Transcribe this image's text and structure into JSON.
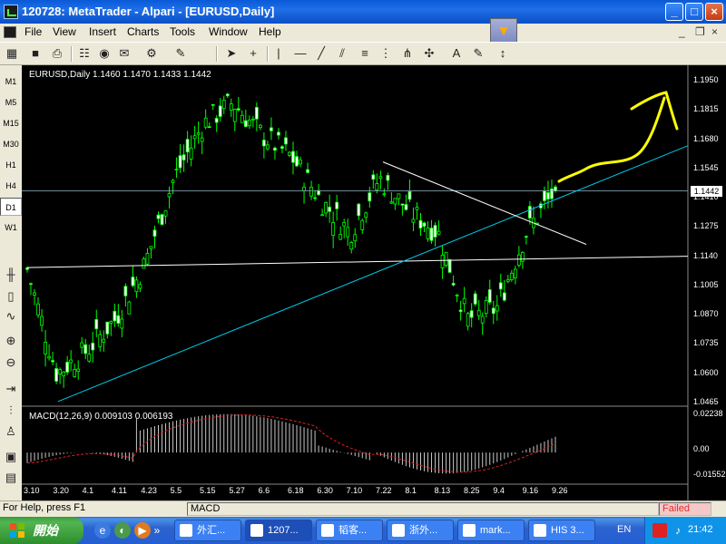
{
  "window": {
    "title": "120728: MetaTrader - Alpari - [EURUSD,Daily]"
  },
  "menu": [
    "File",
    "View",
    "Insert",
    "Charts",
    "Tools",
    "Window",
    "Help"
  ],
  "toolbar": {
    "icons": [
      "new-chart-icon",
      "save-icon",
      "print-icon",
      "market-watch-icon",
      "data-window-icon",
      "navigator-icon",
      "terminal-icon",
      "options-icon",
      "edit-icon",
      "cursor-icon",
      "crosshair-icon",
      "vertical-line-icon",
      "horizontal-line-icon",
      "trendline-icon",
      "channel-icon",
      "fibonacci-icon",
      "gann-icon",
      "pitchfork-icon",
      "text-icon",
      "label-icon",
      "arrows-icon",
      "period-icon"
    ]
  },
  "timeframes": [
    "M1",
    "M5",
    "M15",
    "M30",
    "H1",
    "H4",
    "D1",
    "W1"
  ],
  "active_timeframe": "D1",
  "chart": {
    "info_label": "EURUSD,Daily  1.1460 1.1470 1.1433 1.1442",
    "current_price": "1.1442",
    "price_ticks": [
      "1.1950",
      "1.1815",
      "1.1680",
      "1.1545",
      "1.1410",
      "1.1275",
      "1.1140",
      "1.1005",
      "1.0870",
      "1.0735",
      "1.0600",
      "1.0465"
    ],
    "date_ticks": [
      "3.10",
      "3.20",
      "4.1",
      "4.11",
      "4.23",
      "5.5",
      "5.15",
      "5.27",
      "6.6",
      "6.18",
      "6.30",
      "7.10",
      "7.22",
      "8.1",
      "8.13",
      "8.25",
      "9.4",
      "9.16",
      "9.26"
    ],
    "macd_label": "MACD(12,26,9)  0.009103  0.006193",
    "macd_ticks": [
      "0.02238",
      "0.00",
      "-0.01552"
    ],
    "colors": {
      "bull": "#00ff00",
      "bear": "#00ff00",
      "trendline": "#00c8e6",
      "hline": "#ffffff",
      "annotation": "#ffff00"
    }
  },
  "chart_data": {
    "type": "candlestick",
    "title": "",
    "symbol": "EURUSD",
    "timeframe": "Daily",
    "ylim": [
      1.0465,
      1.195
    ],
    "close_path": [
      [
        "3.10",
        1.108
      ],
      [
        "3.20",
        1.06
      ],
      [
        "4.1",
        1.07
      ],
      [
        "4.11",
        1.085
      ],
      [
        "4.23",
        1.11
      ],
      [
        "5.5",
        1.15
      ],
      [
        "5.15",
        1.175
      ],
      [
        "5.27",
        1.185
      ],
      [
        "6.6",
        1.17
      ],
      [
        "6.18",
        1.16
      ],
      [
        "6.30",
        1.14
      ],
      [
        "7.10",
        1.125
      ],
      [
        "7.22",
        1.15
      ],
      [
        "8.1",
        1.135
      ],
      [
        "8.13",
        1.125
      ],
      [
        "8.25",
        1.085
      ],
      [
        "9.4",
        1.09
      ],
      [
        "9.16",
        1.125
      ],
      [
        "9.26",
        1.1442
      ]
    ],
    "macd": {
      "value": 0.009103,
      "signal": 0.006193,
      "ylim": [
        -0.01552,
        0.02238
      ]
    }
  },
  "statusbar": {
    "help": "For Help, press F1",
    "profile": "MACD",
    "connection": "Failed"
  },
  "taskbar": {
    "start": "開始",
    "tasks": [
      "外汇...",
      "1207...",
      "韬客...",
      "浙外...",
      "mark...",
      "HIS 3..."
    ],
    "active_task": 1,
    "lang": "EN",
    "time": "21:42"
  }
}
